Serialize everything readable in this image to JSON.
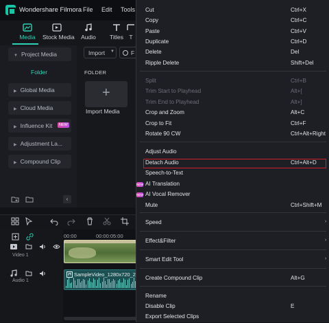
{
  "app": {
    "title": "Wondershare Filmora",
    "menus": [
      "File",
      "Edit",
      "Tools"
    ]
  },
  "toolbar": {
    "tabs": [
      {
        "label": "Media",
        "icon": "media-icon",
        "active": true
      },
      {
        "label": "Stock Media",
        "icon": "stock-media-icon",
        "active": false
      },
      {
        "label": "Audio",
        "icon": "music-note-icon",
        "active": false
      },
      {
        "label": "Titles",
        "icon": "titles-icon",
        "active": false
      },
      {
        "label": "T",
        "icon": "",
        "active": false
      }
    ]
  },
  "sidebar": {
    "items": [
      {
        "label": "Project Media",
        "expanded": true
      },
      {
        "label": "Global Media"
      },
      {
        "label": "Cloud Media"
      },
      {
        "label": "Influence Kit"
      },
      {
        "label": "Adjustment La..."
      },
      {
        "label": "Compound Clip"
      }
    ],
    "folder_label": "Folder",
    "new_badge": "NEW"
  },
  "media": {
    "import_dropdown": "Import",
    "filter_label": "F",
    "folder_header": "FOLDER",
    "import_tile_label": "Import Media"
  },
  "timeline": {
    "ruler_start": "00:00",
    "ruler_mark": "00:00:05:00",
    "tracks": [
      {
        "label": "Video 1",
        "type": "video"
      },
      {
        "label": "Audio 1",
        "type": "audio"
      }
    ],
    "audio_clip_name": "SampleVideo_1280x720_2"
  },
  "context_menu": {
    "items": [
      {
        "label": "Cut",
        "shortcut": "Ctrl+X",
        "disabled": false
      },
      {
        "label": "Copy",
        "shortcut": "Ctrl+C",
        "disabled": false
      },
      {
        "label": "Paste",
        "shortcut": "Ctrl+V",
        "disabled": false
      },
      {
        "label": "Duplicate",
        "shortcut": "Ctrl+D",
        "disabled": false
      },
      {
        "label": "Delete",
        "shortcut": "Del",
        "disabled": false
      },
      {
        "label": "Ripple Delete",
        "shortcut": "Shift+Del",
        "disabled": false
      },
      {
        "label": "Split",
        "shortcut": "Ctrl+B",
        "disabled": true
      },
      {
        "label": "Trim Start to Playhead",
        "shortcut": "Alt+[",
        "disabled": true
      },
      {
        "label": "Trim End to Playhead",
        "shortcut": "Alt+]",
        "disabled": true
      },
      {
        "label": "Crop and Zoom",
        "shortcut": "Alt+C",
        "disabled": false
      },
      {
        "label": "Crop to Fit",
        "shortcut": "Ctrl+F",
        "disabled": false
      },
      {
        "label": "Rotate 90 CW",
        "shortcut": "Ctrl+Alt+Right",
        "disabled": false
      },
      {
        "label": "Adjust Audio",
        "shortcut": "",
        "disabled": false
      },
      {
        "label": "Detach Audio",
        "shortcut": "Ctrl+Alt+D",
        "disabled": false,
        "highlighted": true
      },
      {
        "label": "Speech-to-Text",
        "shortcut": "",
        "disabled": false
      },
      {
        "label": "AI Translation",
        "shortcut": "",
        "disabled": false,
        "badge": "NEW"
      },
      {
        "label": "AI Vocal Remover",
        "shortcut": "",
        "disabled": false,
        "badge": "NEW"
      },
      {
        "label": "Mute",
        "shortcut": "Ctrl+Shift+M",
        "disabled": false
      },
      {
        "label": "Speed",
        "shortcut": "",
        "disabled": false,
        "submenu": true
      },
      {
        "label": "Effect&Filter",
        "shortcut": "",
        "disabled": false,
        "submenu": true
      },
      {
        "label": "Smart Edit Tool",
        "shortcut": "",
        "disabled": false,
        "submenu": true
      },
      {
        "label": "Create Compound Clip",
        "shortcut": "Alt+G",
        "disabled": false
      },
      {
        "label": "Rename",
        "shortcut": "",
        "disabled": false
      },
      {
        "label": "Disable Clip",
        "shortcut": "E",
        "disabled": false
      },
      {
        "label": "Export Selected Clips",
        "shortcut": "",
        "disabled": false
      }
    ],
    "submenu_arrow": "›"
  },
  "colors": {
    "accent": "#2ed3b7",
    "highlight_border": "#d0202b",
    "menu_bg": "#1e1f24"
  }
}
